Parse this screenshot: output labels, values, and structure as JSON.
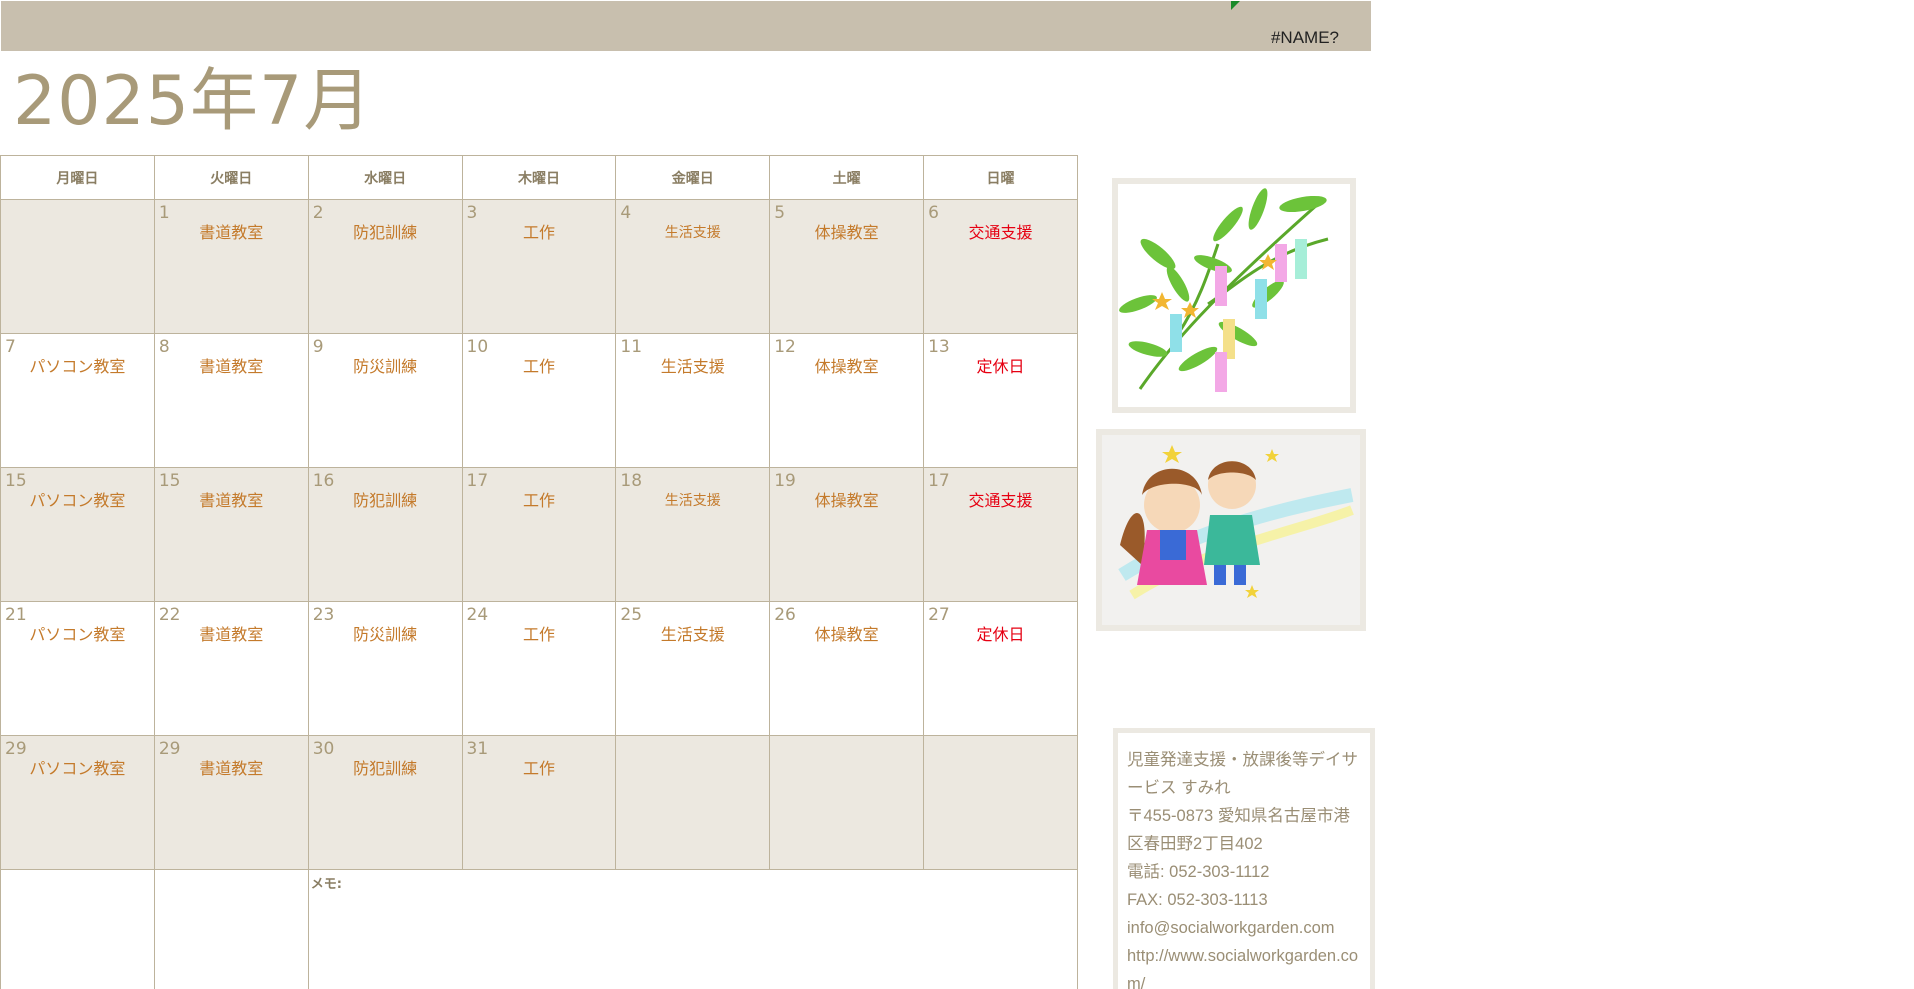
{
  "header": {
    "error_text": "#NAME?"
  },
  "title": "2025年7月",
  "weekdays": [
    "月曜日",
    "火曜日",
    "水曜日",
    "木曜日",
    "金曜日",
    "土曜",
    "日曜"
  ],
  "weeks": [
    {
      "days": [
        {
          "num": "",
          "event": ""
        },
        {
          "num": "1",
          "event": "書道教室"
        },
        {
          "num": "2",
          "event": "防犯訓練"
        },
        {
          "num": "3",
          "event": "工作"
        },
        {
          "num": "4",
          "event": "生活支援"
        },
        {
          "num": "5",
          "event": "体操教室"
        },
        {
          "num": "6",
          "event": "交通支援"
        }
      ]
    },
    {
      "days": [
        {
          "num": "7",
          "event": "パソコン教室"
        },
        {
          "num": "8",
          "event": "書道教室"
        },
        {
          "num": "9",
          "event": "防災訓練"
        },
        {
          "num": "10",
          "event": "工作"
        },
        {
          "num": "11",
          "event": "生活支援"
        },
        {
          "num": "12",
          "event": "体操教室"
        },
        {
          "num": "13",
          "event": "定休日"
        }
      ]
    },
    {
      "days": [
        {
          "num": "15",
          "event": "パソコン教室"
        },
        {
          "num": "15",
          "event": "書道教室"
        },
        {
          "num": "16",
          "event": "防犯訓練"
        },
        {
          "num": "17",
          "event": "工作"
        },
        {
          "num": "18",
          "event": "生活支援"
        },
        {
          "num": "19",
          "event": "体操教室"
        },
        {
          "num": "17",
          "event": "交通支援"
        }
      ]
    },
    {
      "days": [
        {
          "num": "21",
          "event": "パソコン教室"
        },
        {
          "num": "22",
          "event": "書道教室"
        },
        {
          "num": "23",
          "event": "防災訓練"
        },
        {
          "num": "24",
          "event": "工作"
        },
        {
          "num": "25",
          "event": "生活支援"
        },
        {
          "num": "26",
          "event": "体操教室"
        },
        {
          "num": "27",
          "event": "定休日"
        }
      ]
    },
    {
      "days": [
        {
          "num": "29",
          "event": "パソコン教室"
        },
        {
          "num": "29",
          "event": "書道教室"
        },
        {
          "num": "30",
          "event": "防犯訓練"
        },
        {
          "num": "31",
          "event": "工作"
        },
        {
          "num": "",
          "event": ""
        },
        {
          "num": "",
          "event": ""
        },
        {
          "num": "",
          "event": ""
        }
      ]
    }
  ],
  "memo_label": "メモ:",
  "contact": {
    "name": "児童発達支援・放課後等デイサービス すみれ",
    "address": "〒455-0873 愛知県名古屋市港区春田野2丁目402",
    "phone": "電話: 052-303-1112",
    "fax": "FAX: 052-303-1113",
    "email": "info@socialworkgarden.com",
    "url": "http://www.socialworkgarden.com/"
  },
  "images": [
    "tanabata-bamboo-icon",
    "orihime-hikoboshi-icon"
  ],
  "colors": {
    "accent": "#a89a79",
    "header_bar": "#c8bfae",
    "event": "#c47a2b",
    "holiday": "#e60012",
    "shaded_row": "#ece8e0"
  }
}
